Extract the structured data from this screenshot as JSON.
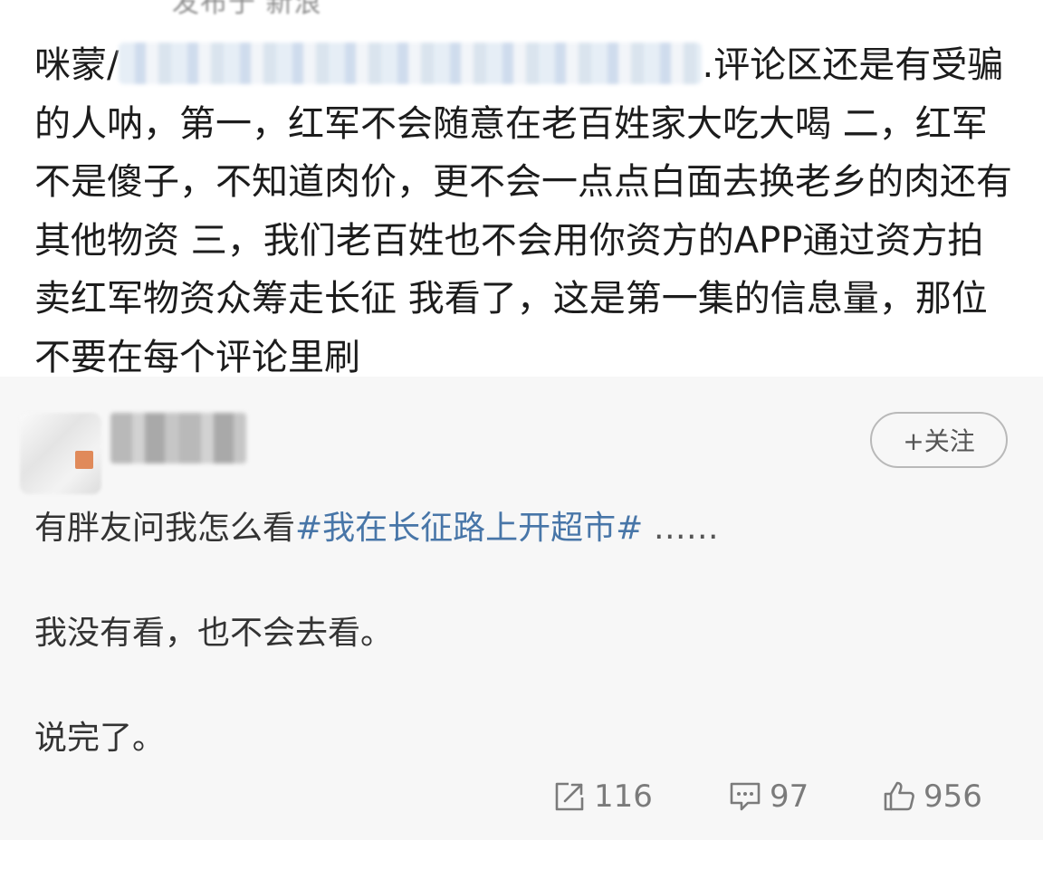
{
  "top_post": {
    "meta": "发布于 新浪",
    "text_before": "咪蒙/",
    "text_after": ".评论区还是有受骗的人呐，第一，红军不会随意在老百姓家大吃大喝 二，红军不是傻子，不知道肉价，更不会一点点白面去换老乡的肉还有其他物资 三，我们老百姓也不会用你资方的APP通过资方拍卖红军物资众筹走长征 我看了，这是第一集的信息量，那位不要在每个评论里刷"
  },
  "repost": {
    "follow_label": "+关注",
    "line1_prefix": "有胖友问我怎么看",
    "line1_hashtag": "#我在长征路上开超市#",
    "line1_ellipsis": " ……",
    "line2": "我没有看，也不会去看。",
    "line3": "说完了。",
    "actions": {
      "reposts": "116",
      "comments": "97",
      "likes": "956"
    }
  },
  "colors": {
    "hashtag": "#4876a8",
    "repost_background": "#f7f7f7",
    "avatar_badge": "#e08a5a"
  },
  "icons": [
    "repost-icon",
    "comment-icon",
    "like-icon"
  ]
}
